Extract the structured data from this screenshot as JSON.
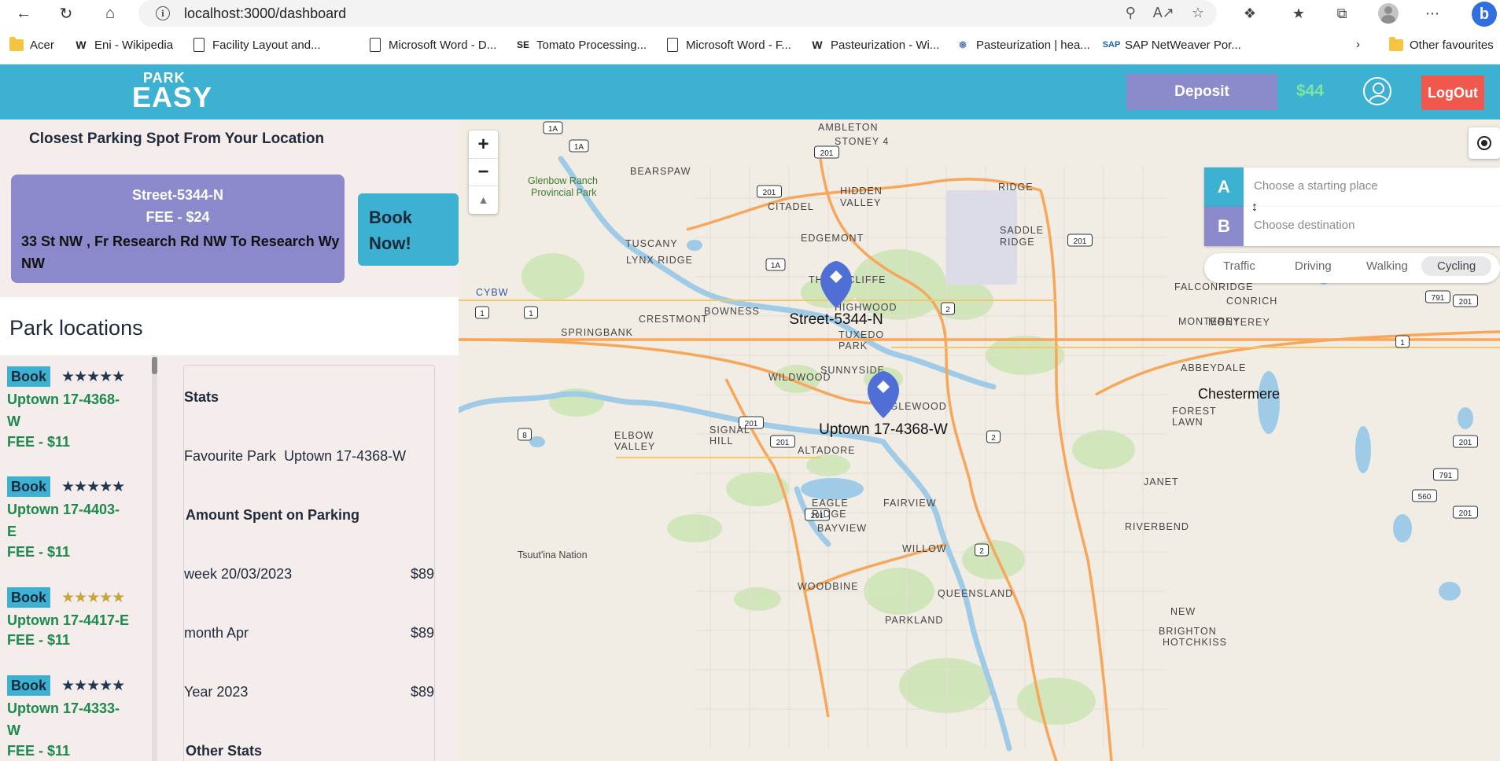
{
  "browser": {
    "url": "localhost:3000/dashboard",
    "bookmarks": [
      {
        "label": "Acer",
        "icon": "folder-icon"
      },
      {
        "label": "Eni - Wikipedia",
        "icon": "wikipedia-icon"
      },
      {
        "label": "Facility Layout and...",
        "icon": "document-icon"
      },
      {
        "label": "Microsoft Word - D...",
        "icon": "document-icon"
      },
      {
        "label": "Tomato Processing...",
        "icon": "se-icon"
      },
      {
        "label": "Microsoft Word - F...",
        "icon": "document-icon"
      },
      {
        "label": "Pasteurization - Wi...",
        "icon": "wikipedia-icon"
      },
      {
        "label": "Pasteurization | hea...",
        "icon": "site-icon"
      },
      {
        "label": "SAP NetWeaver Por...",
        "icon": "sap-icon"
      }
    ],
    "other_favourites": "Other favourites"
  },
  "header": {
    "logo_top": "PARK",
    "logo_bottom": "EASY",
    "deposit_label": "Deposit",
    "balance": "$44",
    "logout_label": "LogOut"
  },
  "closest": {
    "title": "Closest Parking Spot From Your Location",
    "name": "Street-5344-N",
    "fee": "FEE - $24",
    "address": "33 St NW , Fr Research Rd NW To Research Wy NW",
    "book_label_1": "Book",
    "book_label_2": "Now!"
  },
  "park_locations": {
    "title": "Park locations",
    "items": [
      {
        "book": "Book",
        "name_1": "Uptown 17-4368-",
        "name_2": "W",
        "fee": "FEE - $11",
        "stars": "★★★★★",
        "stars_color": "#22384f"
      },
      {
        "book": "Book",
        "name_1": "Uptown 17-4403-",
        "name_2": "E",
        "fee": "FEE - $11",
        "stars": "★★★★★",
        "stars_color": "#22384f"
      },
      {
        "book": "Book",
        "name_1": "Uptown 17-4417-E",
        "name_2": "",
        "fee": "FEE - $11",
        "stars": "★★★★★",
        "stars_color": "#c6a53b"
      },
      {
        "book": "Book",
        "name_1": "Uptown 17-4333-",
        "name_2": "W",
        "fee": "FEE - $11",
        "stars": "★★★★★",
        "stars_color": "#22384f"
      }
    ]
  },
  "stats": {
    "title": "Stats",
    "favourite_label": "Favourite Park",
    "favourite_value": "Uptown 17-4368-W",
    "amount_title": "Amount Spent on Parking",
    "rows": [
      {
        "label": "week 20/03/2023",
        "value": "$89"
      },
      {
        "label": "month Apr",
        "value": "$89"
      },
      {
        "label": "Year 2023",
        "value": "$89"
      }
    ],
    "other_title": "Other Stats"
  },
  "map": {
    "zoom_in": "+",
    "zoom_out": "−",
    "compass": "▲",
    "start_letter": "A",
    "end_letter": "B",
    "start_placeholder": "Choose a starting place",
    "end_placeholder": "Choose destination",
    "modes": [
      "Traffic",
      "Driving",
      "Walking",
      "Cycling"
    ],
    "active_mode": "Cycling",
    "markers": [
      {
        "label": "Street-5344-N"
      },
      {
        "label": "Uptown 17-4368-W"
      }
    ],
    "place_labels": [
      "AMBLETON",
      "STONEY 4",
      "BEARSPAW",
      "Glenbow Ranch",
      "Provincial Park",
      "CITADEL",
      "HIDDEN",
      "VALLEY",
      "TUSCANY",
      "EDGEMONT",
      "LYNX RIDGE",
      "THORNCLIFFE",
      "FALCONRIDGE",
      "CONRICH",
      "CYBW",
      "BOWNESS",
      "HIGHWOOD",
      "CRESTMONT",
      "SPRINGBANK",
      "TUXEDO",
      "PARK",
      "MONTEREY",
      "SUNNYSIDE",
      "ABBEYDALE",
      "WILDWOOD",
      "INGLEWOOD",
      "FOREST",
      "LAWN",
      "Chestermere",
      "SIGNAL",
      "HILL",
      "ELBOW",
      "VALLEY",
      "ALTADORE",
      "JANET",
      "EAGLE",
      "RIDGE",
      "FAIRVIEW",
      "RIVERBEND",
      "BAYVIEW",
      "Tsuut'ina Nation",
      "WILLOW",
      "WOODBINE",
      "QUEENSLAND",
      "PARKLAND",
      "NEW",
      "BRIGHTON",
      "HOTCHKISS",
      "RIDGE",
      "SADDLE",
      "RIDGE",
      "MONTEREY"
    ],
    "road_shields": [
      "1A",
      "1A",
      "1A",
      "201",
      "201",
      "201",
      "1",
      "1",
      "2",
      "201",
      "8",
      "201",
      "201",
      "2",
      "201",
      "201",
      "1",
      "791",
      "791",
      "560",
      "201",
      "2"
    ]
  }
}
